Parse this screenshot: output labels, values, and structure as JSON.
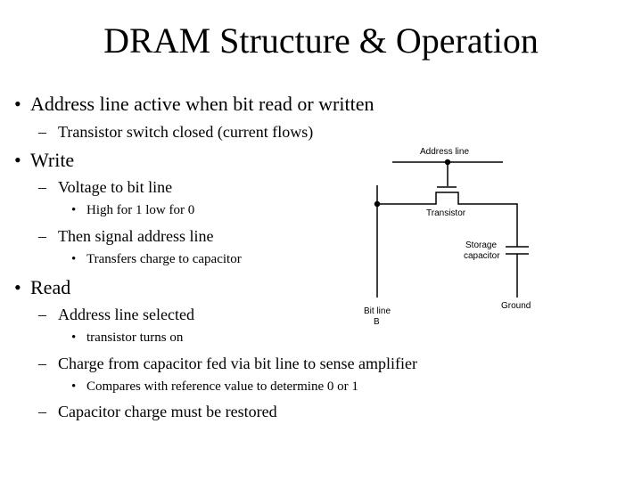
{
  "slide": {
    "title": "DRAM Structure & Operation",
    "bullets": [
      {
        "level": 1,
        "marker": "•",
        "text": "Address line active when bit read or written"
      },
      {
        "level": 2,
        "marker": "–",
        "text": "Transistor switch closed (current flows)"
      },
      {
        "level": 1,
        "marker": "•",
        "text": "Write"
      },
      {
        "level": 2,
        "marker": "–",
        "text": "Voltage to bit line"
      },
      {
        "level": 3,
        "marker": "•",
        "text": "High for 1 low for 0"
      },
      {
        "level": 2,
        "marker": "–",
        "text": "Then signal address line"
      },
      {
        "level": 3,
        "marker": "•",
        "text": "Transfers charge to capacitor"
      },
      {
        "level": 1,
        "marker": "•",
        "text": "Read"
      },
      {
        "level": 2,
        "marker": "–",
        "text": "Address line selected"
      },
      {
        "level": 3,
        "marker": "•",
        "text": "transistor turns on"
      },
      {
        "level": 2,
        "marker": "–",
        "text": "Charge from capacitor fed via bit line to sense amplifier"
      },
      {
        "level": 3,
        "marker": "•",
        "text": "Compares with reference value to determine 0 or 1"
      },
      {
        "level": 2,
        "marker": "–",
        "text": "Capacitor charge must be restored"
      }
    ]
  },
  "diagram": {
    "labels": {
      "address_line": "Address line",
      "transistor": "Transistor",
      "storage_capacitor_1": "Storage",
      "storage_capacitor_2": "capacitor",
      "ground": "Ground",
      "bit_line_1": "Bit line",
      "bit_line_2": "B"
    }
  }
}
